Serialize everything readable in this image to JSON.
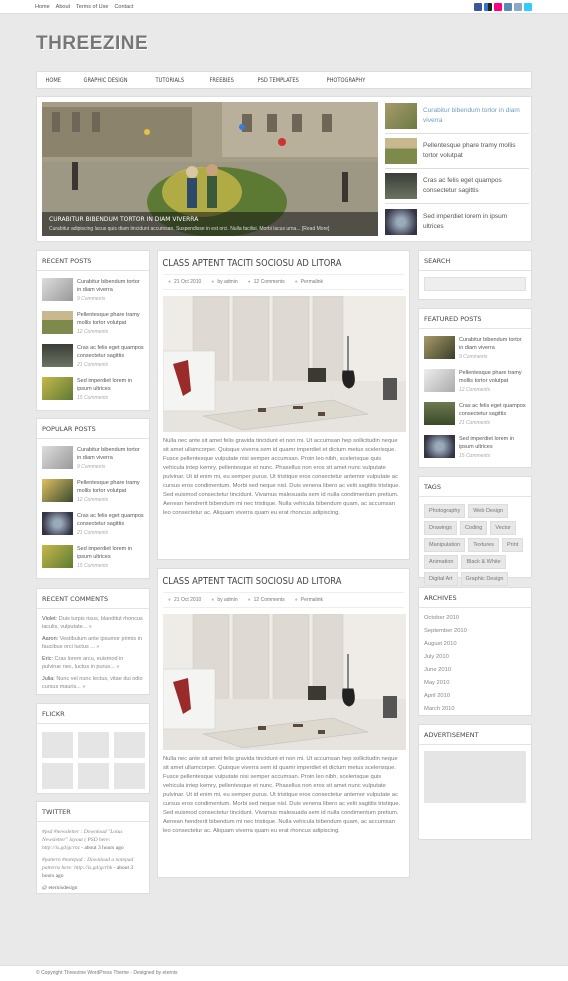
{
  "topbar": {
    "links": [
      "Home",
      "About",
      "Terms of Use",
      "Contact"
    ]
  },
  "site": {
    "logo": "THREEZINE"
  },
  "nav": [
    "HOME",
    "GRAPHIC DESIGN",
    "TUTORIALS",
    "FREEBIES",
    "PSD TEMPLATES",
    "PHOTOGRAPHY"
  ],
  "slider": {
    "caption_title": "Curabitur bibendum tortor in diam viverra",
    "caption_text": "Curabitur adipiscing lacus quis diam tincidunt accumsan. Suspendisse in est orci. Nulla facilisi. Morbi lacus urna... [Read More]",
    "items": [
      "Curabitur bibendum tortor in diam viverra",
      "Pellentesque phare tramy mollis tortor volutpat",
      "Cras ac felis eget quampos consectetur sagittis",
      "Sed imperdiet lorem in ipsum ultrices"
    ]
  },
  "recent_posts": {
    "title": "RECENT POSTS",
    "items": [
      {
        "t": "Curabitur bibendum tortor in diam viverra",
        "c": "9 Comments"
      },
      {
        "t": "Pellentesque phare tramy mollis tortor volutpat",
        "c": "12 Comments"
      },
      {
        "t": "Cras ac felis eget quampos consectetur sagittis",
        "c": "21 Comments"
      },
      {
        "t": "Sed imperdiet lorem in ipsum ultrices",
        "c": "15 Comments"
      }
    ]
  },
  "popular_posts": {
    "title": "POPULAR POSTS",
    "items": [
      {
        "t": "Curabitur bibendum tortor in diam viverra",
        "c": "9 Comments"
      },
      {
        "t": "Pellentesque phare tramy mollis tortor volutpat",
        "c": "12 Comments"
      },
      {
        "t": "Cras ac felis eget quampos consectetur sagittis",
        "c": "21 Comments"
      },
      {
        "t": "Sed imperdiet lorem in ipsum ultrices",
        "c": "15 Comments"
      }
    ]
  },
  "recent_comments": {
    "title": "RECENT COMMENTS",
    "items": [
      {
        "a": "Violet:",
        "t": "Duis turpis risus, blanditut rhoncus iaculis, vulputate... »"
      },
      {
        "a": "Aaron:",
        "t": "Vestibulum ante ipsumor primis in faucibus orci luctus ... »"
      },
      {
        "a": "Eric:",
        "t": "Cras lorem arcu, euismod in pulvinar nec, luctus in purus... »"
      },
      {
        "a": "Julia:",
        "t": "Nunc vel nunc lectus, vitae dui odio cursus mauris... »"
      }
    ]
  },
  "flickr": {
    "title": "FLICKR"
  },
  "twitter": {
    "title": "TWITTER",
    "tweets": [
      {
        "t": "#psd #newsletter : Download \"Lotus Newsletter\" layout ( PSD here: http://is.gd/gcrnz",
        "ago": "about 3 hours ago"
      },
      {
        "t": "#pattern #notepad : Download a notepad patterns here: http://is.gd/gcrbk",
        "ago": "about 3 hours ago"
      }
    ],
    "handle": "@ eternisdesign"
  },
  "posts": [
    {
      "title": "CLASS APTENT TACITI SOCIOSU AD LITORA",
      "date": "21 Oct 2010",
      "author": "by admin",
      "comments": "12 Comments",
      "permalink": "Permalink",
      "body": "Nulla nec ante sit amet felis gravida tincidunt et non mi. Ut accumsan hep sollicitudin neque sit amet ullamcorper. Quisque viverra sem id quamr imperdiet et dictum metus scelerisque. Fusce pellentesque vulputate nisi semper accumsan. Proin leo nibh, scelerisque quis vehicula intep kemry, pellentesque et nunc. Phasellus non eros sit amet nunc vulputate pulvinar. Ut id enim mi, eu semper purus. Ut tristique eros consectetur antemor vulputate ac cursus eros condimentum. Morbi sed neque nisl. Duis venena libero ac velit sagittis tristique. Sed euismod consectetur tincidunt. Vivamus malesuada sem id nulla condimentum pretium. Aenean hendrerit bibendum mi nec tristique. Nulla vehicula bibendum quam, ac accumsan leo consectetur ac. Aliquam viverra quam eu erat rhoncus adipiscing."
    },
    {
      "title": "CLASS APTENT TACITI SOCIOSU AD LITORA",
      "date": "21 Oct 2010",
      "author": "by admin",
      "comments": "12 Comments",
      "permalink": "Permalink",
      "body": "Nulla nec ante sit amet felis gravida tincidunt et non mi. Ut accumsan hep sollicitudin neque sit amet ullamcorper. Quisque viverra sem id quamr imperdiet et dictum metus scelerisque. Fusce pellentesque vulputate nisi semper accumsan. Proin leo nibh, scelerisque quis vehicula intep kemry, pellentesque et nunc. Phasellus non eros sit amet nunc vulputate pulvinar. Ut id enim mi, eu semper purus. Ut tristique eros consectetur antemor vulputate ac cursus eros condimentum. Morbi sed neque nisl. Duis venena libero ac velit sagittis tristique. Sed euismod consectetur tincidunt. Vivamus malesuada sem id nulla condimentum pretium. Aenean hendrerit bibendum mi nec tristique. Nulla vehicula bibendum quam, ac accumsan leo consectetur ac. Aliquam viverra quam eu erat rhoncus adipiscing."
    }
  ],
  "search": {
    "title": "SEARCH"
  },
  "featured_posts": {
    "title": "FEATURED POSTS",
    "items": [
      {
        "t": "Curabitur bibendum tortor in diam viverra",
        "c": "9 Comments"
      },
      {
        "t": "Pellentesque phare tramy mollis tortor volutpat",
        "c": "12 Comments"
      },
      {
        "t": "Cras ac felis eget quampos consectetur sagittis",
        "c": "21 Comments"
      },
      {
        "t": "Sed imperdiet lorem in ipsum ultrices",
        "c": "15 Comments"
      }
    ]
  },
  "tags": {
    "title": "TAGS",
    "items": [
      "Photography",
      "Web Design",
      "Drawings",
      "Coding",
      "Vector",
      "Manipulation",
      "Textures",
      "Print",
      "Animation",
      "Black & White",
      "Digital Art",
      "Graphic Design"
    ]
  },
  "archives": {
    "title": "ARCHIVES",
    "items": [
      "October 2010",
      "September 2010",
      "August 2010",
      "July 2010",
      "June 2010",
      "May 2010",
      "April 2010",
      "March 2010"
    ]
  },
  "advertisement": {
    "title": "ADVERTISEMENT"
  },
  "footer": {
    "text": "© Copyright Threezine WordPress Theme - Designed by eternis"
  },
  "colors": {
    "accent": "#6e9ec0",
    "bg": "#e9e9e9"
  }
}
